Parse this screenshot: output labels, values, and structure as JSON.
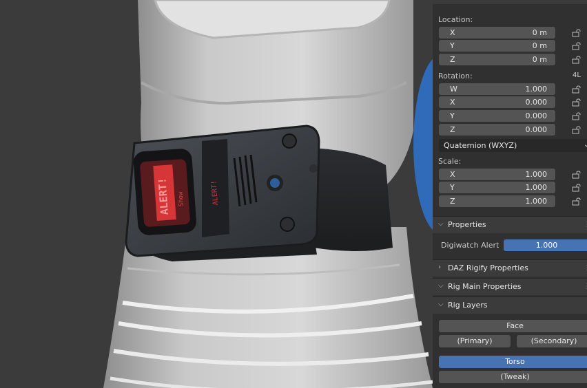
{
  "panel": {
    "location": {
      "label": "Location:",
      "rows": [
        {
          "axis": "X",
          "value": "0 m"
        },
        {
          "axis": "Y",
          "value": "0 m"
        },
        {
          "axis": "Z",
          "value": "0 m"
        }
      ]
    },
    "rotation": {
      "label": "Rotation:",
      "mode_badge": "4L",
      "rows": [
        {
          "axis": "W",
          "value": "1.000"
        },
        {
          "axis": "X",
          "value": "0.000"
        },
        {
          "axis": "Y",
          "value": "0.000"
        },
        {
          "axis": "Z",
          "value": "0.000"
        }
      ],
      "mode": "Quaternion (WXYZ)"
    },
    "scale": {
      "label": "Scale:",
      "rows": [
        {
          "axis": "X",
          "value": "1.000"
        },
        {
          "axis": "Y",
          "value": "1.000"
        },
        {
          "axis": "Z",
          "value": "1.000"
        }
      ]
    },
    "properties": {
      "title": "Properties",
      "prop_label": "Digiwatch Alert",
      "prop_value": "1.000"
    },
    "sections": {
      "daz": "DAZ Rigify Properties",
      "rig_main": "Rig Main Properties",
      "rig_layers": "Rig Layers"
    },
    "layers": {
      "face": "Face",
      "primary": "(Primary)",
      "secondary": "(Secondary)",
      "torso": "Torso",
      "tweak": "(Tweak)"
    }
  },
  "viewport": {
    "watch_screen_text": "ALERT!",
    "watch_screen_sub": "Show",
    "watch_side_text": "ALERT!"
  },
  "colors": {
    "accent": "#4772b3",
    "field": "#545454",
    "panel": "#303030",
    "header": "#3b3b3b"
  }
}
